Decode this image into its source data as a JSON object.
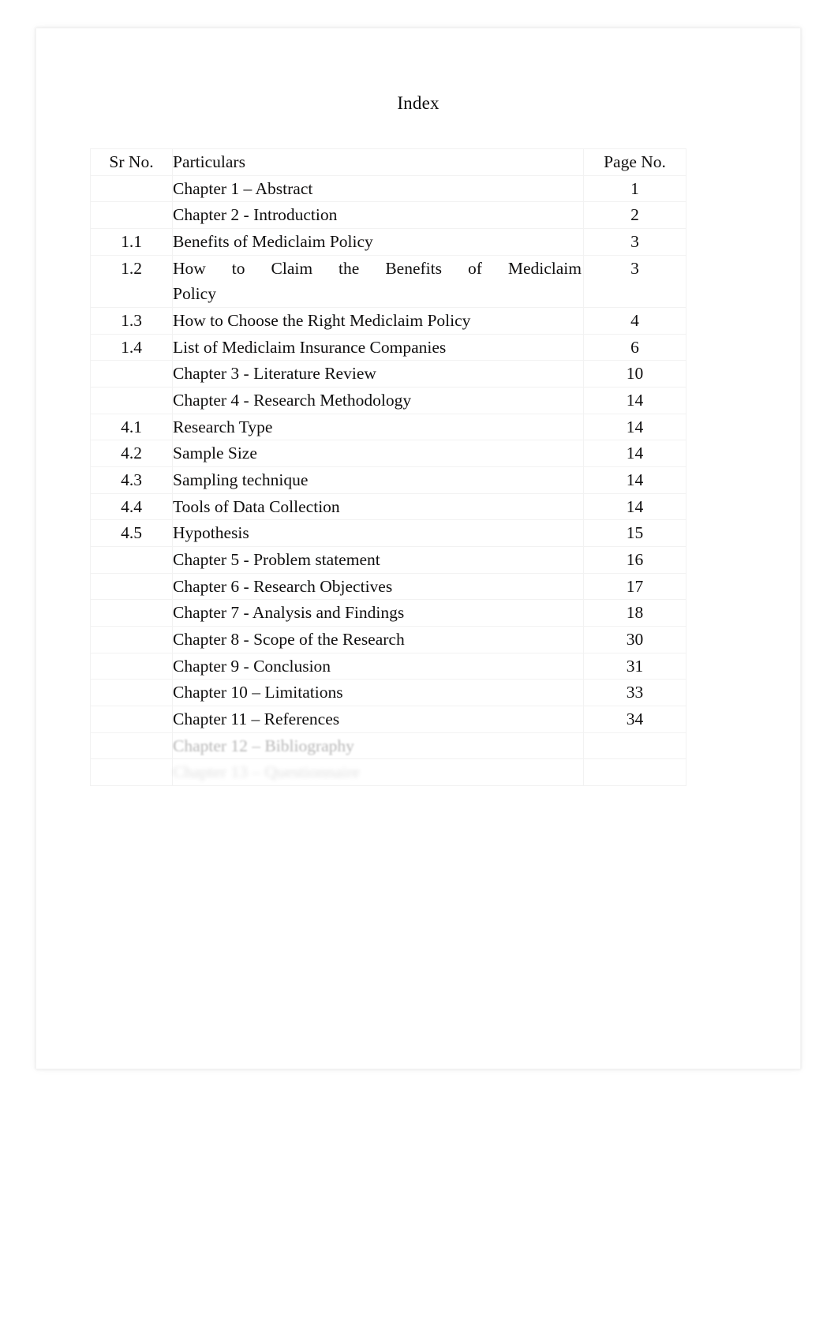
{
  "document": {
    "title": "Index",
    "background_color": "#ffffff",
    "page_color": "#ffffff",
    "text_color": "#100f0f"
  },
  "table": {
    "headers": {
      "sr_no": "Sr No.",
      "particulars": "Particulars",
      "page_no": "Page No."
    },
    "rows": [
      {
        "sr": "",
        "particulars": "Chapter 1  – Abstract",
        "page": "1"
      },
      {
        "sr": "",
        "particulars": "Chapter 2 - Introduction",
        "page": "2"
      },
      {
        "sr": "1.1",
        "particulars": "Benefits of Mediclaim Policy",
        "page": "3"
      },
      {
        "sr": "1.2",
        "particulars": "How to Claim the Benefits of Mediclaim Policy",
        "particulars_line1": "How to Claim the Benefits of Mediclaim",
        "particulars_line2": "Policy",
        "page": "3",
        "justified": true
      },
      {
        "sr": "1.3",
        "particulars": "How to Choose the Right Mediclaim Policy",
        "page": "4"
      },
      {
        "sr": "1.4",
        "particulars": "List of Mediclaim Insurance Companies",
        "page": "6"
      },
      {
        "sr": "",
        "particulars": "Chapter 3 - Literature Review",
        "page": "10"
      },
      {
        "sr": "",
        "particulars": "Chapter 4 - Research Methodology",
        "page": "14"
      },
      {
        "sr": "4.1",
        "particulars": "Research Type",
        "page": "14"
      },
      {
        "sr": "4.2",
        "particulars": "Sample Size",
        "page": "14"
      },
      {
        "sr": "4.3",
        "particulars": "Sampling technique",
        "page": "14"
      },
      {
        "sr": "4.4",
        "particulars": "Tools of Data Collection",
        "page": "14"
      },
      {
        "sr": "4.5",
        "particulars": "Hypothesis",
        "page": "15"
      },
      {
        "sr": "",
        "particulars": "Chapter 5 - Problem statement",
        "page": "16"
      },
      {
        "sr": "",
        "particulars": "Chapter 6 - Research Objectives",
        "page": "17"
      },
      {
        "sr": "",
        "particulars": "Chapter 7 - Analysis and Findings",
        "page": "18"
      },
      {
        "sr": "",
        "particulars": "Chapter 8 - Scope of the Research",
        "page": "30"
      },
      {
        "sr": "",
        "particulars": "Chapter 9 - Conclusion",
        "page": "31"
      },
      {
        "sr": "",
        "particulars": "Chapter 10  – Limitations",
        "page": "33"
      },
      {
        "sr": "",
        "particulars": "Chapter 11  – References",
        "page": "34"
      },
      {
        "sr": "",
        "particulars": "Chapter 12  – Bibliography",
        "page": "",
        "fade": 1
      },
      {
        "sr": "",
        "particulars": "Chapter 13  – Questionnaire",
        "page": "",
        "fade": 2
      }
    ]
  }
}
